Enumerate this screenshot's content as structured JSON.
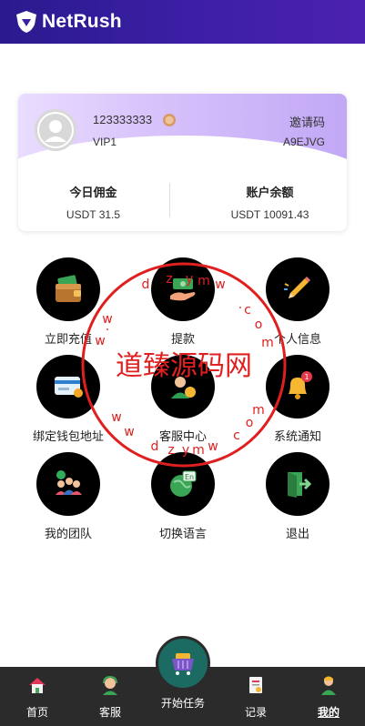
{
  "app": {
    "name": "NetRush"
  },
  "profile": {
    "username": "123333333",
    "level": "VIP1",
    "invite_label": "邀请码",
    "invite_code": "A9EJVG"
  },
  "stats": [
    {
      "title": "今日佣金",
      "value": "USDT 31.5"
    },
    {
      "title": "账户余额",
      "value": "USDT 10091.43"
    }
  ],
  "menu": [
    {
      "label": "立即充值",
      "icon": "wallet-icon"
    },
    {
      "label": "提款",
      "icon": "cash-withdraw-icon"
    },
    {
      "label": "个人信息",
      "icon": "pencil-icon"
    },
    {
      "label": "绑定钱包地址",
      "icon": "card-icon"
    },
    {
      "label": "客服中心",
      "icon": "support-icon"
    },
    {
      "label": "系统通知",
      "icon": "bell-icon"
    },
    {
      "label": "我的团队",
      "icon": "team-icon"
    },
    {
      "label": "切换语言",
      "icon": "language-icon"
    },
    {
      "label": "退出",
      "icon": "logout-icon"
    }
  ],
  "watermark": {
    "text": "道臻源码网",
    "ring_text": "www.dzym.com",
    "color": "#e02020"
  },
  "nav": [
    {
      "label": "首页",
      "icon": "home-icon"
    },
    {
      "label": "客服",
      "icon": "headset-icon"
    },
    {
      "label": "开始任务",
      "icon": "cart-icon"
    },
    {
      "label": "记录",
      "icon": "document-icon"
    },
    {
      "label": "我的",
      "icon": "user-icon",
      "active": true
    }
  ],
  "colors": {
    "header": "#3d1fa6",
    "nav_bg": "#2b2b2b",
    "center_button": "#1b6b63"
  }
}
